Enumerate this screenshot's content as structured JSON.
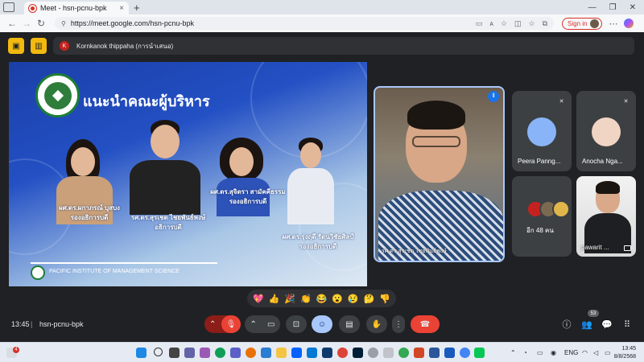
{
  "browser": {
    "tab_title": "Meet - hsn-pcnu-bpk",
    "tab_close": "×",
    "new_tab": "+",
    "url": "https://meet.google.com/hsn-pcnu-bpk",
    "sign_in": "Sign in",
    "window_controls": [
      "—",
      "❐",
      "✕"
    ]
  },
  "meet": {
    "presenter_initial": "K",
    "presenter_text": "Kornkanok thippaha (การนำเสนอ)",
    "slide": {
      "title": "แนะนำคณะผู้บริหาร",
      "people": [
        {
          "name": "ผศ.ดร.ผกาภรณ์ บุสบง",
          "role": "รองอธิการบดี"
        },
        {
          "name": "รศ.ดร.สุรเชต ไชยพันธ์พงษ์",
          "role": "อธิการบดี"
        },
        {
          "name": "ผศ.ดร.สุจิตรา สามัคคีธรรม",
          "role": "รองอธิการบดี"
        },
        {
          "name": "ผศ.ดร.รุ่งฤดี รัตนวิชัยศิลป์",
          "role": "รองอธิการบดี"
        }
      ],
      "footer": "PACIFIC INSTITUTE OF MANAGEMENT SCIENCE"
    },
    "speaker_name": "รศ.ดร.สุรเชต ไชยพันธ์พงษ์",
    "participants": [
      {
        "name": "Peera Panng..."
      },
      {
        "name": "Anocha Nga..."
      },
      {
        "name": "pawarit ..."
      }
    ],
    "more_label": "อีก 48 คน",
    "reactions": [
      "💖",
      "👍",
      "🎉",
      "👏",
      "😂",
      "😮",
      "😢",
      "🤔",
      "👎"
    ],
    "time": "13:45",
    "separator": "|",
    "meeting_code": "hsn-pcnu-bpk",
    "people_count": "53"
  },
  "taskbar": {
    "notif_count": "4",
    "lang": "ENG",
    "clock_time": "13:45",
    "clock_date": "8/8/2568"
  }
}
